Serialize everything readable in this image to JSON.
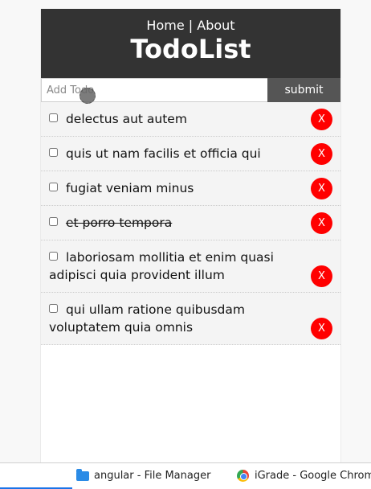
{
  "nav": {
    "home": "Home",
    "separator": "|",
    "about": "About"
  },
  "app_title": "TodoList",
  "form": {
    "placeholder": "Add Todo",
    "submit_label": "submit"
  },
  "todos": [
    {
      "title": "delectus aut autem",
      "completed": false,
      "delete_label": "X"
    },
    {
      "title": "quis ut nam facilis et officia qui",
      "completed": false,
      "delete_label": "X"
    },
    {
      "title": "fugiat veniam minus",
      "completed": false,
      "delete_label": "X"
    },
    {
      "title": "et porro tempora",
      "completed": true,
      "delete_label": "X"
    },
    {
      "title": "laboriosam mollitia et enim quasi adipisci quia provident illum",
      "completed": false,
      "delete_label": "X"
    },
    {
      "title": "qui ullam ratione quibusdam voluptatem quia omnis",
      "completed": false,
      "delete_label": "X"
    }
  ],
  "taskbar": {
    "file_manager": "angular - File Manager",
    "chrome": "iGrade - Google Chrome"
  },
  "colors": {
    "header_bg": "#333333",
    "delete_button": "#ff0000",
    "submit_bg": "#555555",
    "item_bg": "#f4f4f4"
  }
}
